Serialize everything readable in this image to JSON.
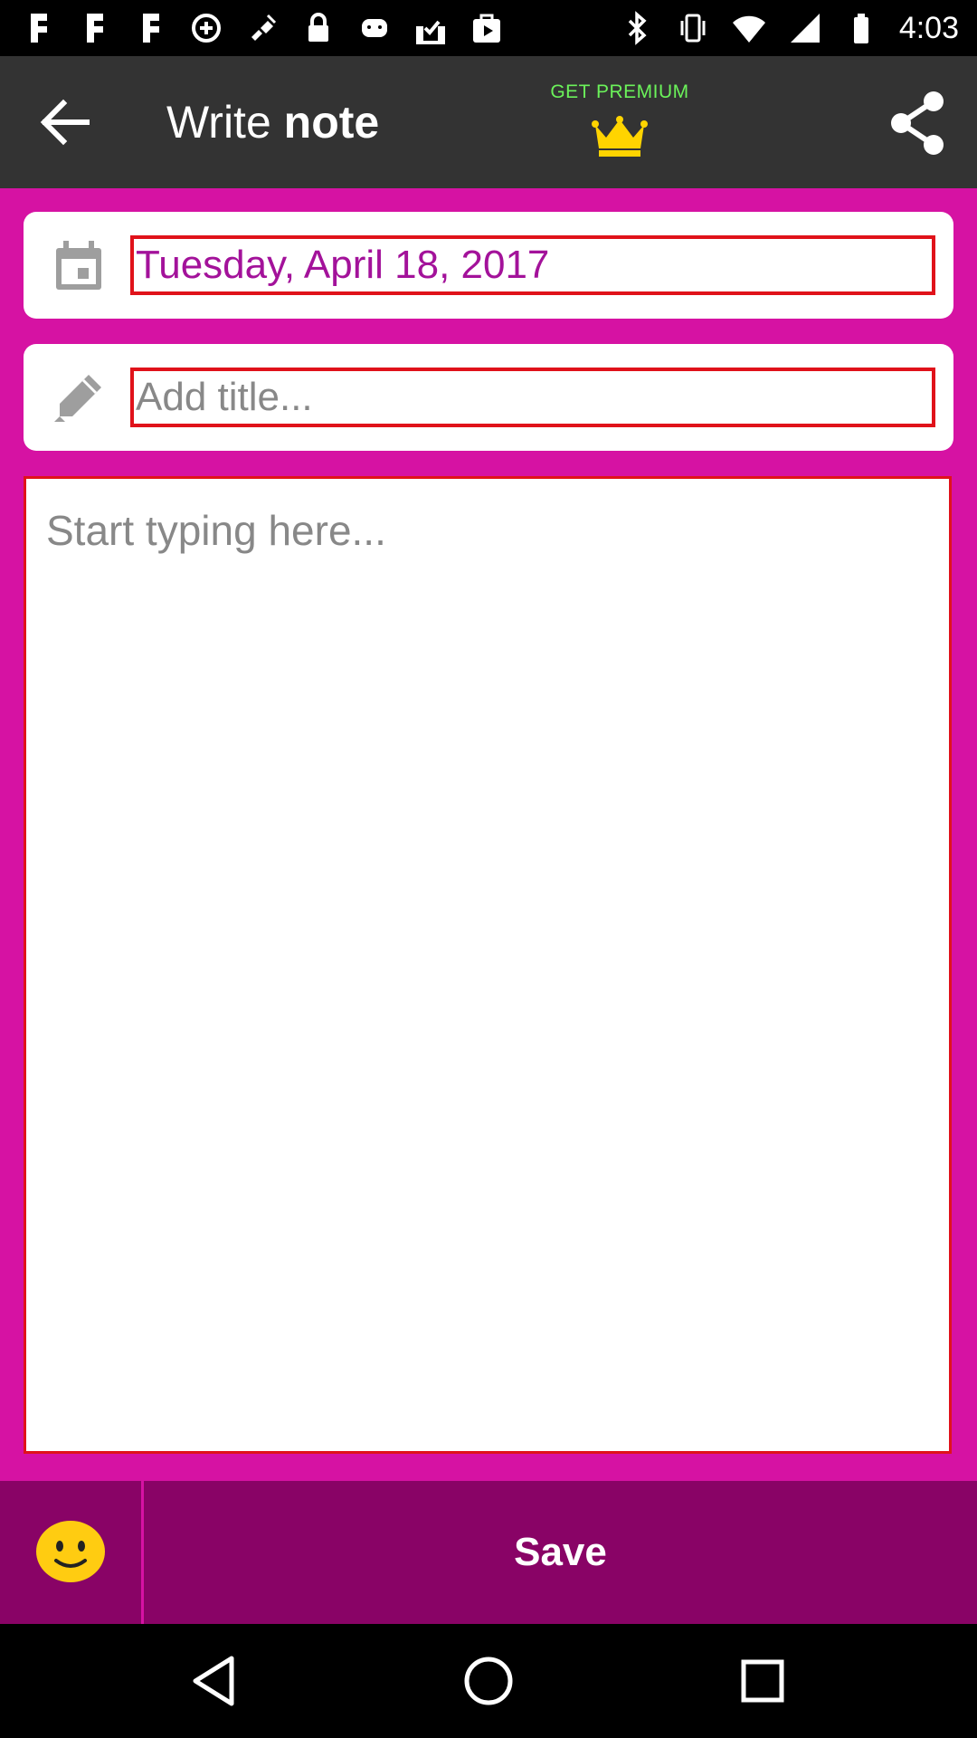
{
  "status_bar": {
    "time": "4:03",
    "left_icons": [
      "facebook-icon",
      "facebook-icon",
      "facebook-icon",
      "data-saver-icon",
      "fake-gps-icon",
      "lock-icon",
      "android-icon",
      "task-check-icon",
      "play-store-icon"
    ],
    "right_icons": [
      "bluetooth-icon",
      "vibrate-icon",
      "wifi-icon",
      "signal-icon",
      "battery-icon"
    ]
  },
  "app_bar": {
    "title_regular": "Write",
    "title_bold": "note",
    "premium_label": "GET PREMIUM",
    "premium_icon": "crown-icon",
    "share_icon": "share-icon",
    "back_icon": "arrow-back-icon"
  },
  "form": {
    "date_value": "Tuesday, April 18, 2017",
    "date_icon": "calendar-icon",
    "title_placeholder": "Add title...",
    "title_icon": "pencil-icon",
    "note_placeholder": "Start typing here..."
  },
  "bottom": {
    "emoji_icon": "smiley-icon",
    "save_label": "Save"
  },
  "colors": {
    "app_bar": "#333333",
    "background": "#d612a3",
    "bottom_bar": "#890366",
    "input_border": "#e0121a",
    "date_text": "#a3129a",
    "premium_text": "#6bf25a",
    "crown": "#ffd400"
  }
}
